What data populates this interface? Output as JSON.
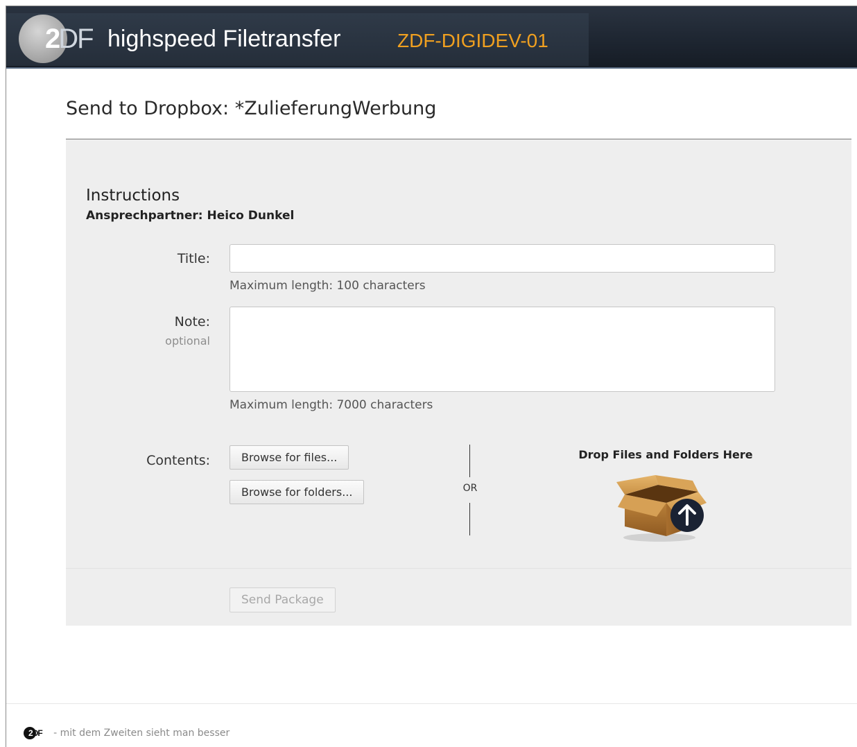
{
  "header": {
    "logo_primary": "2",
    "logo_secondary": "DF",
    "app_title": "highspeed Filetransfer",
    "server_name": "ZDF-DIGIDEV-01"
  },
  "page": {
    "title": "Send to Dropbox: *ZulieferungWerbung"
  },
  "instructions": {
    "heading": "Instructions",
    "text": "Ansprechpartner: Heico Dunkel"
  },
  "form": {
    "title_label": "Title:",
    "title_value": "",
    "title_hint": "Maximum length: 100 characters",
    "note_label": "Note:",
    "note_sublabel": "optional",
    "note_value": "",
    "note_hint": "Maximum length: 7000 characters",
    "contents_label": "Contents:",
    "browse_files_label": "Browse for files...",
    "browse_folders_label": "Browse for folders...",
    "or_label": "OR",
    "drop_zone_label": "Drop Files and Folders Here",
    "send_button_label": "Send Package"
  },
  "footer": {
    "logo_primary": "2",
    "logo_secondary": "DF",
    "text": "- mit dem Zweiten sieht man besser"
  },
  "icons": {
    "drop_zone": "box-upload-icon",
    "upload_arrow": "arrow-up-icon"
  },
  "colors": {
    "header_bg": "#1d2530",
    "server_name": "#f0a020",
    "panel_bg": "#eeeeee",
    "upload_badge": "#1a2233"
  }
}
